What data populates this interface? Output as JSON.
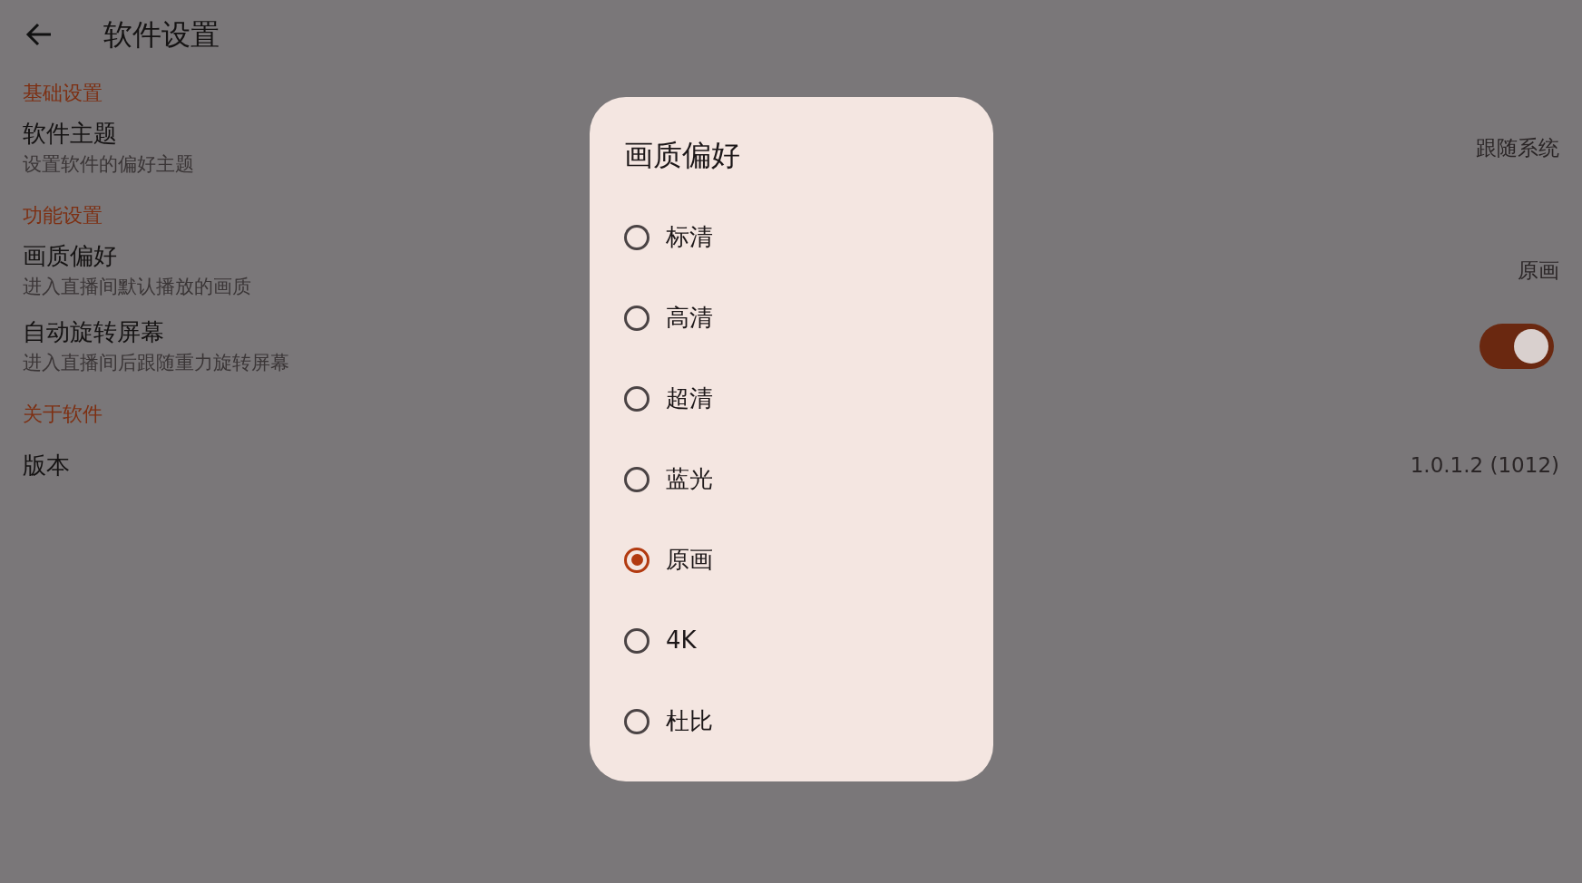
{
  "app_bar": {
    "title": "软件设置"
  },
  "sections": [
    {
      "header": "基础设置",
      "items": [
        {
          "kind": "value",
          "title": "软件主题",
          "subtitle": "设置软件的偏好主题",
          "value": "跟随系统"
        }
      ]
    },
    {
      "header": "功能设置",
      "items": [
        {
          "kind": "value",
          "title": "画质偏好",
          "subtitle": "进入直播间默认播放的画质",
          "value": "原画"
        },
        {
          "kind": "switch",
          "title": "自动旋转屏幕",
          "subtitle": "进入直播间后跟随重力旋转屏幕",
          "on": true
        }
      ]
    },
    {
      "header": "关于软件",
      "items": [
        {
          "kind": "value",
          "title": "版本",
          "value": "1.0.1.2 (1012)"
        }
      ]
    }
  ],
  "dialog": {
    "title": "画质偏好",
    "options": [
      {
        "label": "标清",
        "selected": false
      },
      {
        "label": "高清",
        "selected": false
      },
      {
        "label": "超清",
        "selected": false
      },
      {
        "label": "蓝光",
        "selected": false
      },
      {
        "label": "原画",
        "selected": true
      },
      {
        "label": "4K",
        "selected": false
      },
      {
        "label": "杜比",
        "selected": false
      }
    ]
  }
}
